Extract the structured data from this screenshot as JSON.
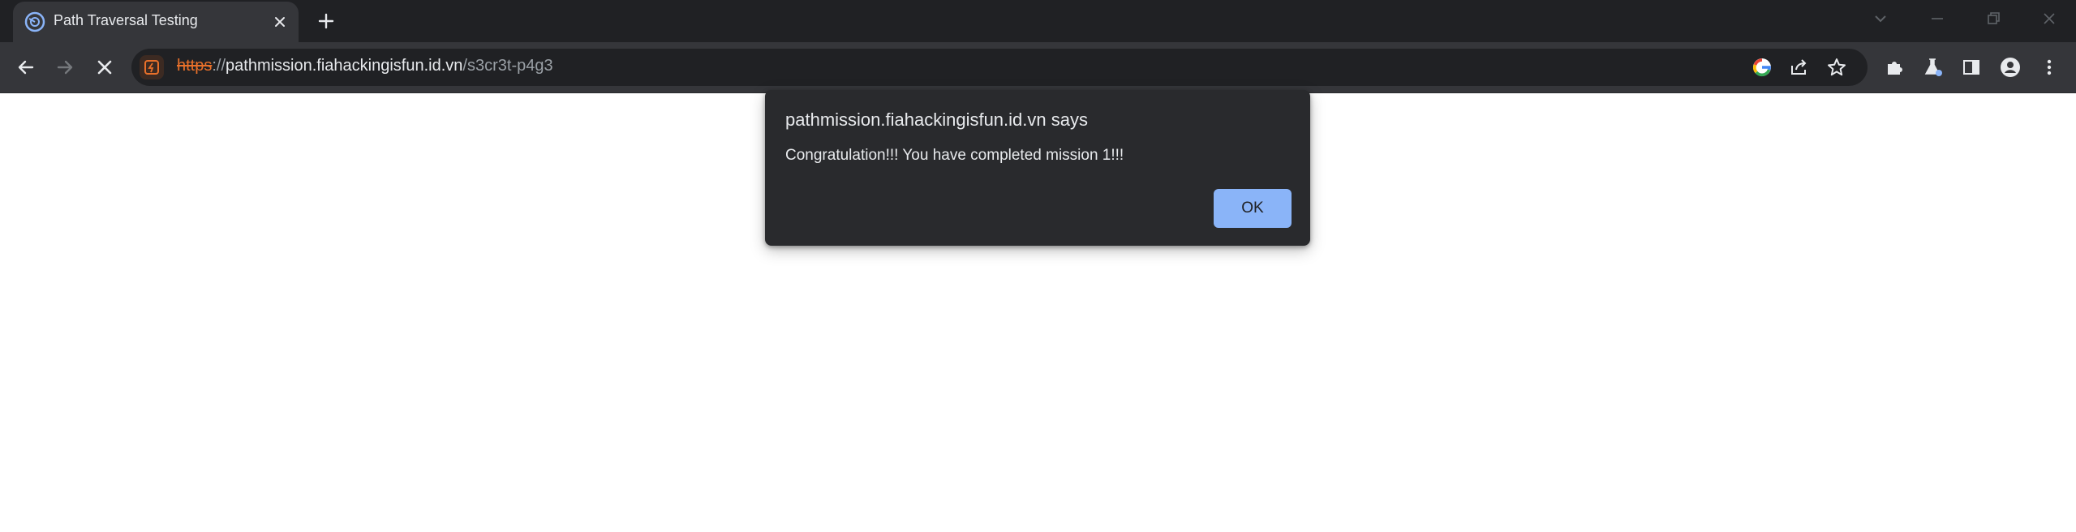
{
  "tab": {
    "title": "Path Traversal Testing",
    "favicon": "chrome-circle-icon"
  },
  "address_bar": {
    "scheme": "https",
    "separator": "://",
    "host": "pathmission.fiahackingisfun.id.vn",
    "path": "/s3cr3t-p4g3",
    "security_state": "not-secure-strikethrough"
  },
  "navigation": {
    "back_enabled": true,
    "forward_enabled": false,
    "loading": true
  },
  "dialog": {
    "title": "pathmission.fiahackingisfun.id.vn says",
    "message": "Congratulation!!! You have completed mission 1!!!",
    "ok_label": "OK"
  },
  "colors": {
    "tabstrip": "#202124",
    "toolbar": "#35363a",
    "dialog_bg": "#292a2d",
    "ok_button": "#8ab4f8",
    "scheme_warning": "#e8702a"
  }
}
